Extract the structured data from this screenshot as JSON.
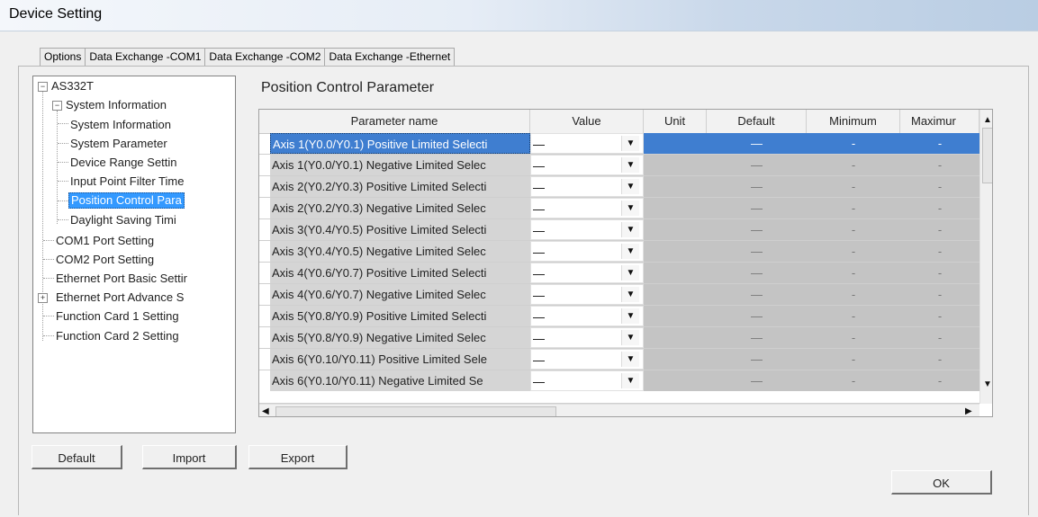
{
  "window": {
    "title": "Device Setting"
  },
  "tabs": [
    {
      "label": "Options",
      "active": false
    },
    {
      "label": "Data Exchange -COM1",
      "active": false
    },
    {
      "label": "Data Exchange -COM2",
      "active": false
    },
    {
      "label": "Data Exchange -Ethernet",
      "active": false
    }
  ],
  "tree": {
    "root": "AS332T",
    "system_information": "System Information",
    "children": {
      "system_information": "System Information",
      "system_parameter": "System Parameter",
      "device_range": "Device Range Settin",
      "input_point_filter": "Input Point Filter Time",
      "position_control": "Position Control Para",
      "daylight_saving": "Daylight Saving Timi"
    },
    "com1": "COM1 Port Setting",
    "com2": "COM2 Port Setting",
    "ethernet_basic": "Ethernet Port Basic Settir",
    "ethernet_advance": "Ethernet Port Advance S",
    "function_card_1": "Function Card 1 Setting",
    "function_card_2": "Function Card 2 Setting"
  },
  "section": {
    "title": "Position Control Parameter"
  },
  "grid": {
    "columns": [
      "Parameter name",
      "Value",
      "Unit",
      "Default",
      "Minimum",
      "Maximur"
    ],
    "rows": [
      {
        "name": "Axis 1(Y0.0/Y0.1) Positive Limited Selecti",
        "value": "—",
        "unit": "",
        "default": "—",
        "minimum": "-",
        "maximum": "-"
      },
      {
        "name": "Axis 1(Y0.0/Y0.1) Negative Limited Selec",
        "value": "—",
        "unit": "",
        "default": "—",
        "minimum": "-",
        "maximum": "-"
      },
      {
        "name": "Axis 2(Y0.2/Y0.3) Positive Limited Selecti",
        "value": "—",
        "unit": "",
        "default": "—",
        "minimum": "-",
        "maximum": "-"
      },
      {
        "name": "Axis 2(Y0.2/Y0.3) Negative Limited Selec",
        "value": "—",
        "unit": "",
        "default": "—",
        "minimum": "-",
        "maximum": "-"
      },
      {
        "name": "Axis 3(Y0.4/Y0.5) Positive Limited Selecti",
        "value": "—",
        "unit": "",
        "default": "—",
        "minimum": "-",
        "maximum": "-"
      },
      {
        "name": "Axis 3(Y0.4/Y0.5) Negative Limited Selec",
        "value": "—",
        "unit": "",
        "default": "—",
        "minimum": "-",
        "maximum": "-"
      },
      {
        "name": "Axis 4(Y0.6/Y0.7) Positive Limited Selecti",
        "value": "—",
        "unit": "",
        "default": "—",
        "minimum": "-",
        "maximum": "-"
      },
      {
        "name": "Axis 4(Y0.6/Y0.7) Negative Limited Selec",
        "value": "—",
        "unit": "",
        "default": "—",
        "minimum": "-",
        "maximum": "-"
      },
      {
        "name": "Axis 5(Y0.8/Y0.9) Positive Limited Selecti",
        "value": "—",
        "unit": "",
        "default": "—",
        "minimum": "-",
        "maximum": "-"
      },
      {
        "name": "Axis 5(Y0.8/Y0.9) Negative Limited Selec",
        "value": "—",
        "unit": "",
        "default": "—",
        "minimum": "-",
        "maximum": "-"
      },
      {
        "name": "Axis 6(Y0.10/Y0.11) Positive Limited Sele",
        "value": "—",
        "unit": "",
        "default": "—",
        "minimum": "-",
        "maximum": "-"
      },
      {
        "name": "Axis 6(Y0.10/Y0.11) Negative Limited Se",
        "value": "—",
        "unit": "",
        "default": "—",
        "minimum": "-",
        "maximum": "-"
      }
    ]
  },
  "buttons": {
    "default": "Default",
    "import": "Import",
    "export": "Export",
    "ok": "OK"
  },
  "colors": {
    "selection": "#3399ff",
    "row_selection": "#3f7ed0"
  }
}
